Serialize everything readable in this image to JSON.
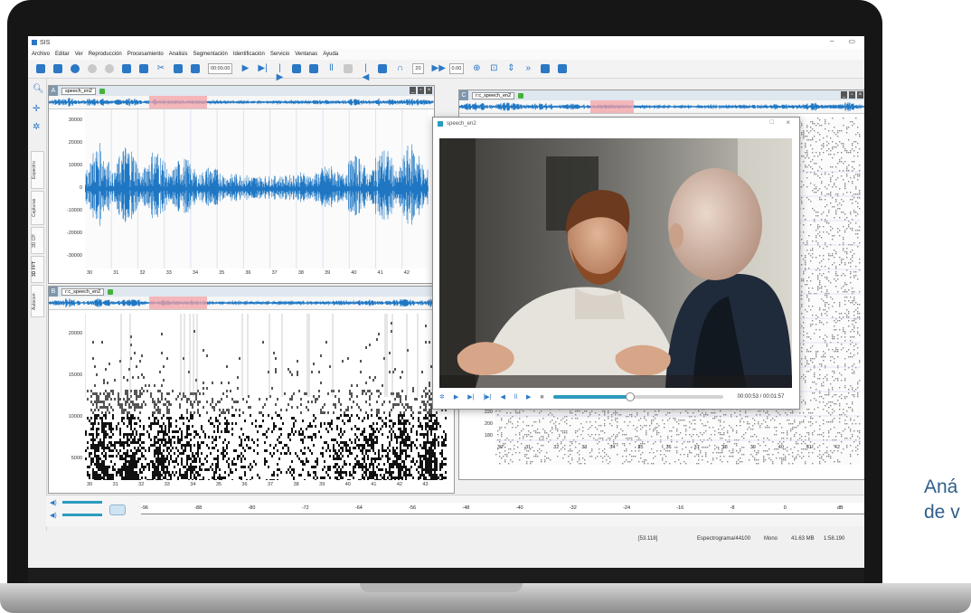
{
  "app": {
    "title": "SIS",
    "menu": [
      "Archivo",
      "Editar",
      "Ver",
      "Reproducción",
      "Procesamiento",
      "Analisis",
      "Segmentación",
      "Identificación",
      "Servicio",
      "Ventanas",
      "Ayuda"
    ]
  },
  "toolbar": {
    "time_field": "00:00.00",
    "field_20": "20",
    "field_000": "0.00"
  },
  "left_tabs": [
    "Espectro",
    "Capturas",
    "3D CP.",
    "3D FFT",
    "Autocorr."
  ],
  "panel_a": {
    "letter": "A",
    "tab": "speech_en2",
    "yticks": [
      "30000",
      "20000",
      "10000",
      "0",
      "-10000",
      "-20000",
      "-30000"
    ],
    "xticks": [
      "30",
      "31",
      "32",
      "33",
      "34",
      "35",
      "36",
      "37",
      "38",
      "39",
      "40",
      "41",
      "42"
    ]
  },
  "panel_b": {
    "letter": "B",
    "tab": "r:c_speech_en2",
    "yticks": [
      "20000",
      "15000",
      "10000",
      "5000"
    ],
    "xticks": [
      "30",
      "31",
      "32",
      "33",
      "34",
      "35",
      "36",
      "37",
      "38",
      "39",
      "40",
      "41",
      "42",
      "43"
    ]
  },
  "panel_c": {
    "letter": "C",
    "tab": "r:c_speech_en2",
    "yticks": [
      "220",
      "200",
      "180"
    ],
    "xticks": [
      "30",
      "31",
      "32",
      "33",
      "34",
      "35",
      "36",
      "37",
      "38",
      "39",
      "40",
      "41",
      "42"
    ]
  },
  "video": {
    "title": "speech_en2",
    "time": "00:00:53 / 00:01:57",
    "progress": 0.45
  },
  "level_meter": {
    "labels": [
      "-96",
      "-88",
      "-80",
      "-72",
      "-64",
      "-56",
      "-48",
      "-40",
      "-32",
      "-24",
      "-16",
      "-8",
      "0",
      "dB"
    ]
  },
  "status": {
    "position": "[53.118]",
    "mode": "Espectrograma/44100",
    "channel": "Mono",
    "size": "41.63 MB",
    "duration": "1:58.190"
  },
  "caption": {
    "line1": "Aná",
    "line2": "de v"
  },
  "colors": {
    "waveform": "#1f77c4",
    "accent": "#2b78c6",
    "selection": "#f4a0a6",
    "laptop_frame": "#161616"
  }
}
